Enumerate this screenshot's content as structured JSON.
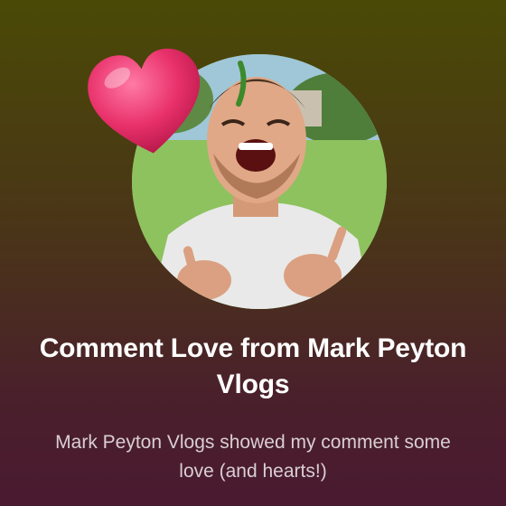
{
  "notification": {
    "title": "Comment Love from Mark Peyton Vlogs",
    "subtitle": "Mark Peyton Vlogs showed my comment some love (and hearts!)"
  },
  "icons": {
    "reaction": "heart-icon",
    "profile": "avatar"
  },
  "colors": {
    "background_top": "#4a4a06",
    "background_bottom": "#4a1a30",
    "heart": "#e8306a",
    "title_text": "#ffffff",
    "subtitle_text": "#d9cfd2"
  }
}
